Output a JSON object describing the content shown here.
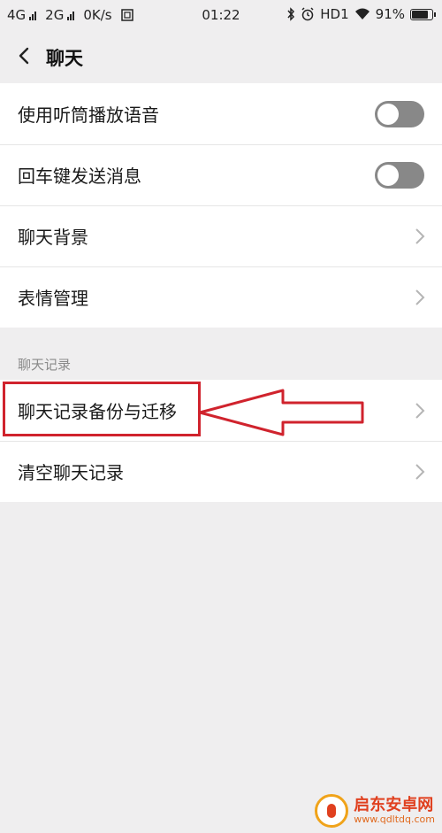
{
  "status_bar": {
    "sim1": "4G",
    "sim2": "2G",
    "speed": "0K/s",
    "time": "01:22",
    "hd": "HD1",
    "battery": "91%",
    "battery_level": 0.91
  },
  "nav": {
    "title": "聊天"
  },
  "group1": {
    "items": [
      {
        "label": "使用听筒播放语音",
        "control": "toggle",
        "on": false
      },
      {
        "label": "回车键发送消息",
        "control": "toggle",
        "on": false
      },
      {
        "label": "聊天背景",
        "control": "chevron"
      },
      {
        "label": "表情管理",
        "control": "chevron"
      }
    ]
  },
  "section": {
    "label": "聊天记录"
  },
  "group2": {
    "items": [
      {
        "label": "聊天记录备份与迁移",
        "control": "chevron"
      },
      {
        "label": "清空聊天记录",
        "control": "chevron"
      }
    ]
  },
  "watermark": {
    "name": "启东安卓网",
    "url": "www.qdltdq.com"
  },
  "colors": {
    "background": "#efeeef",
    "toggle_off": "#888888",
    "annotation_red": "#d0232d"
  }
}
